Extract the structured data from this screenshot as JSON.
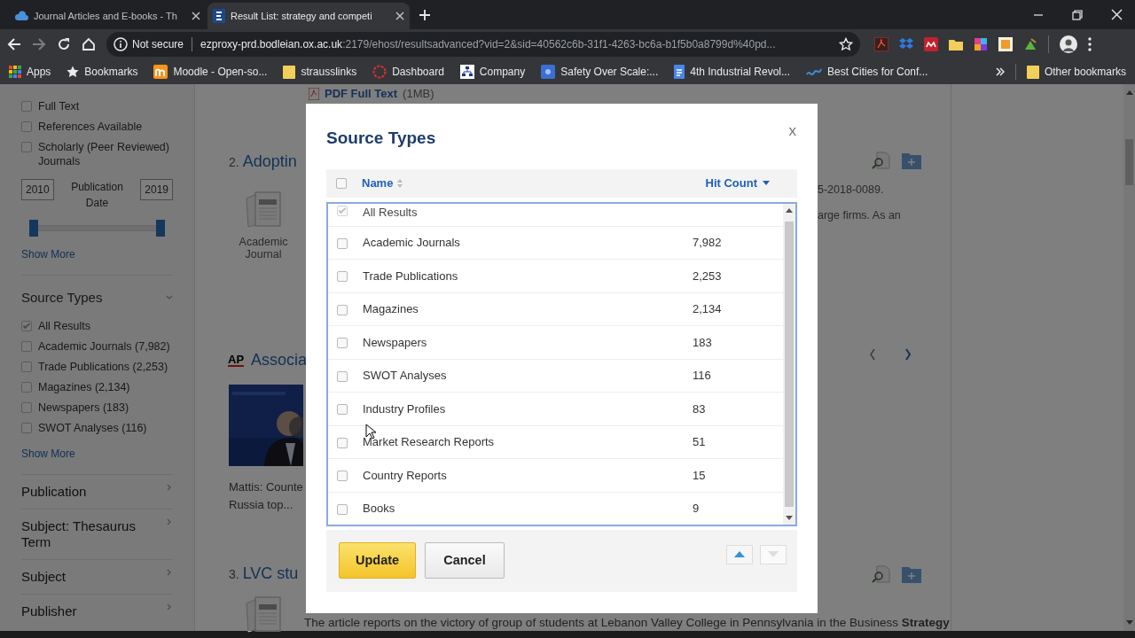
{
  "browser": {
    "tabs": [
      {
        "title": "Journal Articles and E-books - Th",
        "kind": "cloud",
        "selected": false
      },
      {
        "title": "Result List: strategy and competi",
        "kind": "letter",
        "selected": true
      }
    ],
    "address": {
      "security": "Not secure",
      "host": "ezproxy-prd.bodleian.ox.ac.uk",
      "path": ":2179/ehost/resultsadvanced?vid=2&sid=40562c6b-31f1-4263-bc6a-b1f5b0a8799d%40pd..."
    },
    "bookmarks": [
      {
        "label": "Apps",
        "kind": "apps"
      },
      {
        "label": "Bookmarks",
        "kind": "star"
      },
      {
        "label": "Moodle - Open-so...",
        "kind": "moodle"
      },
      {
        "label": "strausslinks",
        "kind": "folder"
      },
      {
        "label": "Dashboard",
        "kind": "ring"
      },
      {
        "label": "Company",
        "kind": "org"
      },
      {
        "label": "Safety Over Scale:...",
        "kind": "square"
      },
      {
        "label": "4th Industrial Revol...",
        "kind": "doc"
      },
      {
        "label": "Best Cities for Conf...",
        "kind": "wave"
      }
    ],
    "other_bookmarks": "Other bookmarks"
  },
  "sidebar": {
    "limiters": [
      {
        "label": "Full Text",
        "checked": false
      },
      {
        "label": "References Available",
        "checked": false
      },
      {
        "label": "Scholarly (Peer Reviewed) Journals",
        "checked": false
      }
    ],
    "date": {
      "from": "2010",
      "label": "Publication Date",
      "to": "2019",
      "thumbs": [
        {
          "level": 0
        },
        {
          "level": 1
        }
      ]
    },
    "show_more": "Show More",
    "source_types": {
      "title": "Source Types",
      "expanded": true,
      "items": [
        {
          "label": "All Results",
          "checked": true
        },
        {
          "label": "Academic Journals (7,982)",
          "checked": false
        },
        {
          "label": "Trade Publications (2,253)",
          "checked": false
        },
        {
          "label": "Magazines (2,134)",
          "checked": false
        },
        {
          "label": "Newspapers (183)",
          "checked": false
        },
        {
          "label": "SWOT Analyses (116)",
          "checked": false
        }
      ],
      "show_more": "Show More"
    },
    "facets": [
      "Publication",
      "Subject: Thesaurus Term",
      "Subject",
      "Publisher"
    ]
  },
  "results": {
    "pdf_link": {
      "label": "PDF Full Text",
      "size": "(1MB)"
    },
    "items": [
      {
        "kind": "article",
        "number": "2.",
        "title": "Adoptin",
        "type_label": "Academic Journal",
        "snippet": [
          "5-2018-0089.",
          "arge firms. As an"
        ]
      },
      {
        "kind": "video",
        "source_logo": "AP",
        "title": "Associa",
        "caption": [
          "Mattis: Counte",
          "Russia top..."
        ]
      },
      {
        "kind": "article",
        "number": "3.",
        "title": "LVC stu",
        "summary": "The article reports on the victory of group of students at Lebanon Valley College in Pennsylvania in the Business **Strategy**"
      }
    ]
  },
  "modal": {
    "title": "Source Types",
    "close": "x",
    "select_all": {
      "checked": false
    },
    "columns": {
      "name": "Name",
      "hit_count": "Hit Count"
    },
    "rows": [
      {
        "name": "All Results",
        "count": "",
        "checked": true,
        "disabled": true
      },
      {
        "name": "Academic Journals",
        "count": "7,982",
        "checked": false,
        "disabled": false
      },
      {
        "name": "Trade Publications",
        "count": "2,253",
        "checked": false,
        "disabled": false
      },
      {
        "name": "Magazines",
        "count": "2,134",
        "checked": false,
        "disabled": false
      },
      {
        "name": "Newspapers",
        "count": "183",
        "checked": false,
        "disabled": false
      },
      {
        "name": "SWOT Analyses",
        "count": "116",
        "checked": false,
        "disabled": false
      },
      {
        "name": "Industry Profiles",
        "count": "83",
        "checked": false,
        "disabled": false
      },
      {
        "name": "Market Research Reports",
        "count": "51",
        "checked": false,
        "disabled": false
      },
      {
        "name": "Country Reports",
        "count": "15",
        "checked": false,
        "disabled": false
      },
      {
        "name": "Books",
        "count": "9",
        "checked": false,
        "disabled": false
      }
    ],
    "buttons": [
      {
        "label": "Update",
        "kind": "primary"
      },
      {
        "label": "Cancel",
        "kind": "secondary"
      }
    ],
    "move_buttons": [
      {
        "kind": "up",
        "disabled": false
      },
      {
        "kind": "down",
        "disabled": true
      }
    ]
  }
}
